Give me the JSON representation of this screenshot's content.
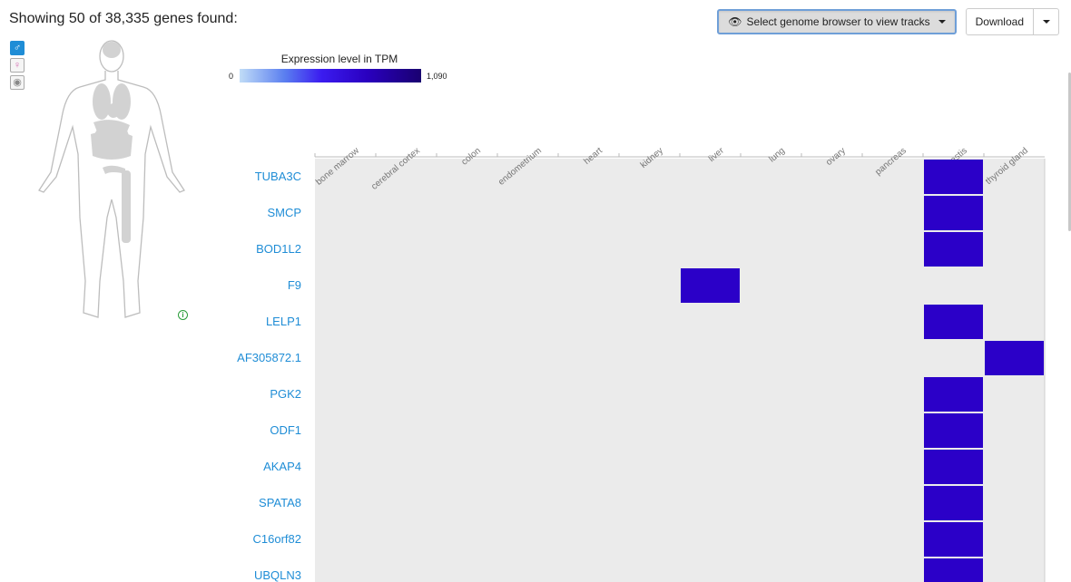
{
  "header": {
    "title": "Showing 50 of 38,335 genes found:",
    "genome_browser_label": "Select genome browser to view tracks",
    "download_label": "Download"
  },
  "legend": {
    "title": "Expression level in TPM",
    "min": "0",
    "max": "1,090",
    "colors": [
      "#c0dcf7",
      "#3b1cf0",
      "#190070"
    ]
  },
  "side_icons": [
    "male-icon",
    "female-icon",
    "brain-icon"
  ],
  "heatmap": {
    "cell_color": "#2b00c8",
    "empty_color": "#ebebeb",
    "tissues": [
      "bone marrow",
      "cerebral cortex",
      "colon",
      "endometrium",
      "heart",
      "kidney",
      "liver",
      "lung",
      "ovary",
      "pancreas",
      "testis",
      "thyroid gland"
    ],
    "genes": [
      {
        "name": "TUBA3C",
        "tissues": [
          "testis"
        ]
      },
      {
        "name": "SMCP",
        "tissues": [
          "testis"
        ]
      },
      {
        "name": "BOD1L2",
        "tissues": [
          "testis"
        ]
      },
      {
        "name": "F9",
        "tissues": [
          "liver"
        ]
      },
      {
        "name": "LELP1",
        "tissues": [
          "testis"
        ]
      },
      {
        "name": "AF305872.1",
        "tissues": [
          "thyroid gland"
        ]
      },
      {
        "name": "PGK2",
        "tissues": [
          "testis"
        ]
      },
      {
        "name": "ODF1",
        "tissues": [
          "testis"
        ]
      },
      {
        "name": "AKAP4",
        "tissues": [
          "testis"
        ]
      },
      {
        "name": "SPATA8",
        "tissues": [
          "testis"
        ]
      },
      {
        "name": "C16orf82",
        "tissues": [
          "testis"
        ]
      },
      {
        "name": "UBQLN3",
        "tissues": [
          "testis"
        ]
      }
    ]
  }
}
